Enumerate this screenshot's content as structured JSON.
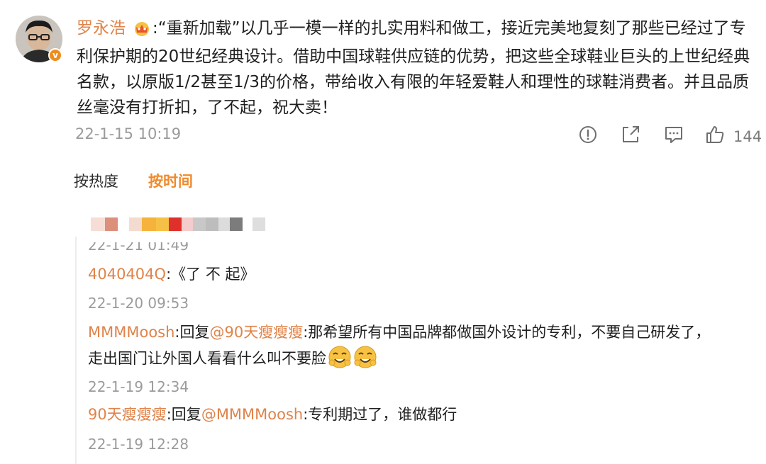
{
  "post": {
    "username": "罗永浩",
    "body": ":“重新加载”以几乎一模一样的扎实用料和做工，接近完美地复刻了那些已经过了专利保护期的20世纪经典设计。借助中国球鞋供应链的优势，把这些全球鞋业巨头的上世纪经典名款，以原版1/2甚至1/3的价格，带给收入有限的年轻爱鞋人和理性的球鞋消费者。并且品质丝毫没有打折扣，了不起，祝大卖！",
    "date": "22-1-15 10:19",
    "verified_mark": "v",
    "like_count": "144"
  },
  "actions": {
    "icons": [
      "report-icon",
      "share-icon",
      "comment-icon",
      "like-icon"
    ]
  },
  "sort": {
    "hot_label": "按热度",
    "time_label": "按时间",
    "active": "按时间"
  },
  "comments": [
    {
      "date": "22-1-21 01:49"
    },
    {
      "user": "4040404Q",
      "text": ":《了 不 起》",
      "date": "22-1-20 09:53"
    },
    {
      "user": "MMMMoosh",
      "reply_prefix": ":回复",
      "mention": "@90天瘦瘦瘦",
      "text_line1": ":那希望所有中国品牌都做国外设计的专利，不要自己研发了，",
      "text_line2": "走出国门让外国人看看什么叫不要脸",
      "emoji": [
        "smirk-emoji",
        "smirk-emoji"
      ],
      "date": "22-1-19 12:34"
    },
    {
      "user": "90天瘦瘦瘦",
      "reply_prefix": ":回复",
      "mention": "@MMMMoosh",
      "text": ":专利期过了，谁做都行",
      "date": "22-1-19 12:28"
    }
  ],
  "colors": {
    "username": "#e0834a",
    "active_tab": "#f08a2c",
    "muted": "#9b9b9b",
    "verified_badge": "#f08c1a"
  }
}
